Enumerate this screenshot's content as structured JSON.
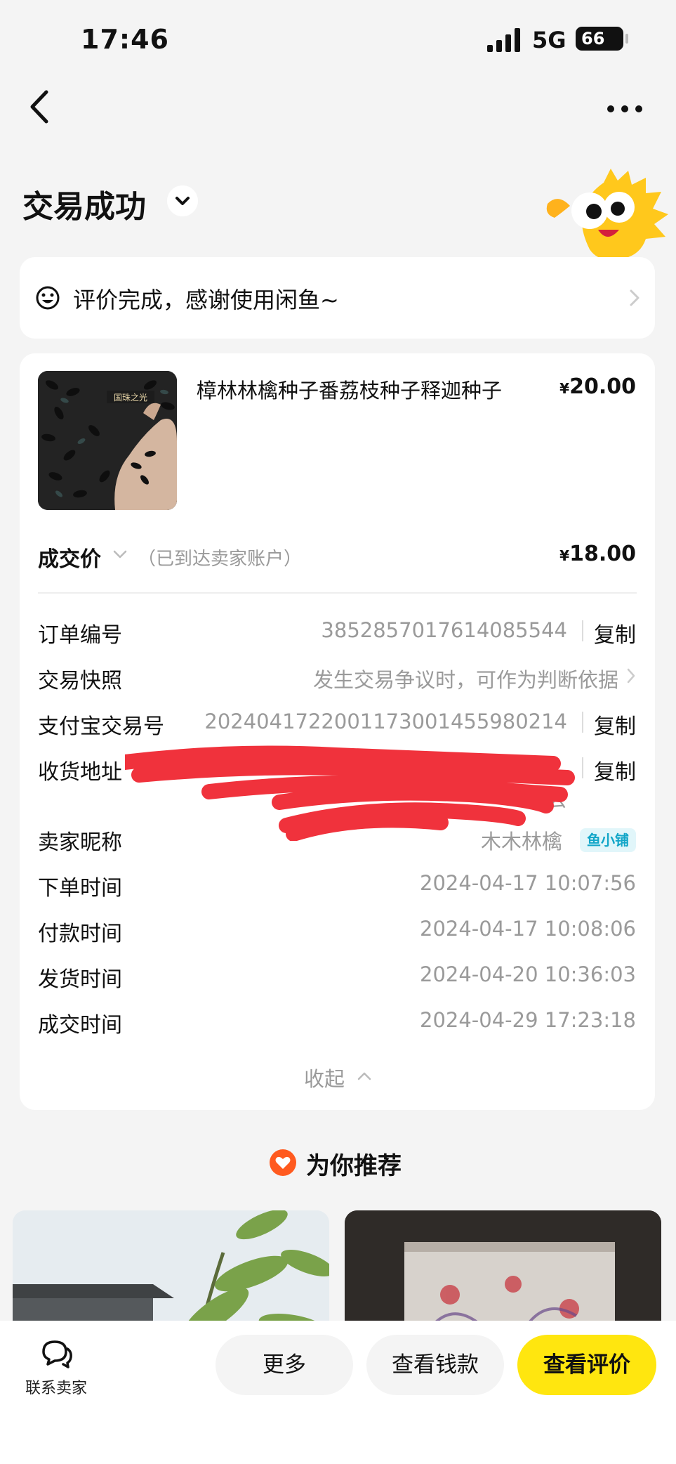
{
  "status": {
    "time": "17:46",
    "network": "5G",
    "battery": "66"
  },
  "header": {
    "title": "交易成功"
  },
  "review_banner": {
    "text": "评价完成，感谢使用闲鱼~"
  },
  "product": {
    "title": "樟林林檎种子番荔枝种子释迦种子",
    "currency": "¥",
    "price": "20.00",
    "image_caption": "国珠之光"
  },
  "deal": {
    "label": "成交价",
    "note": "（已到达卖家账户）",
    "currency": "¥",
    "price": "18.00"
  },
  "details": {
    "order_no_label": "订单编号",
    "order_no": "3852857017614085544",
    "snapshot_label": "交易快照",
    "snapshot_value": "发生交易争议时，可作为判断依据",
    "alipay_label": "支付宝交易号",
    "alipay_no": "2024041722001173001455980214",
    "address_label": "收货地址",
    "address_tail": "去",
    "copy_label": "复制",
    "seller_label": "卖家昵称",
    "seller_name": "木木林檎",
    "seller_badge": "鱼小铺",
    "order_time_label": "下单时间",
    "order_time": "2024-04-17 10:07:56",
    "pay_time_label": "付款时间",
    "pay_time": "2024-04-17 10:08:06",
    "ship_time_label": "发货时间",
    "ship_time": "2024-04-20 10:36:03",
    "deal_time_label": "成交时间",
    "deal_time": "2024-04-29 17:23:18",
    "collapse_label": "收起"
  },
  "recommend": {
    "title": "为你推荐"
  },
  "bottom_bar": {
    "contact_label": "联系卖家",
    "more_label": "更多",
    "money_label": "查看钱款",
    "review_label": "查看评价"
  },
  "colors": {
    "accent_yellow": "#ffe60f",
    "badge_blue": "#12a6c8",
    "redaction": "#f0323c"
  }
}
